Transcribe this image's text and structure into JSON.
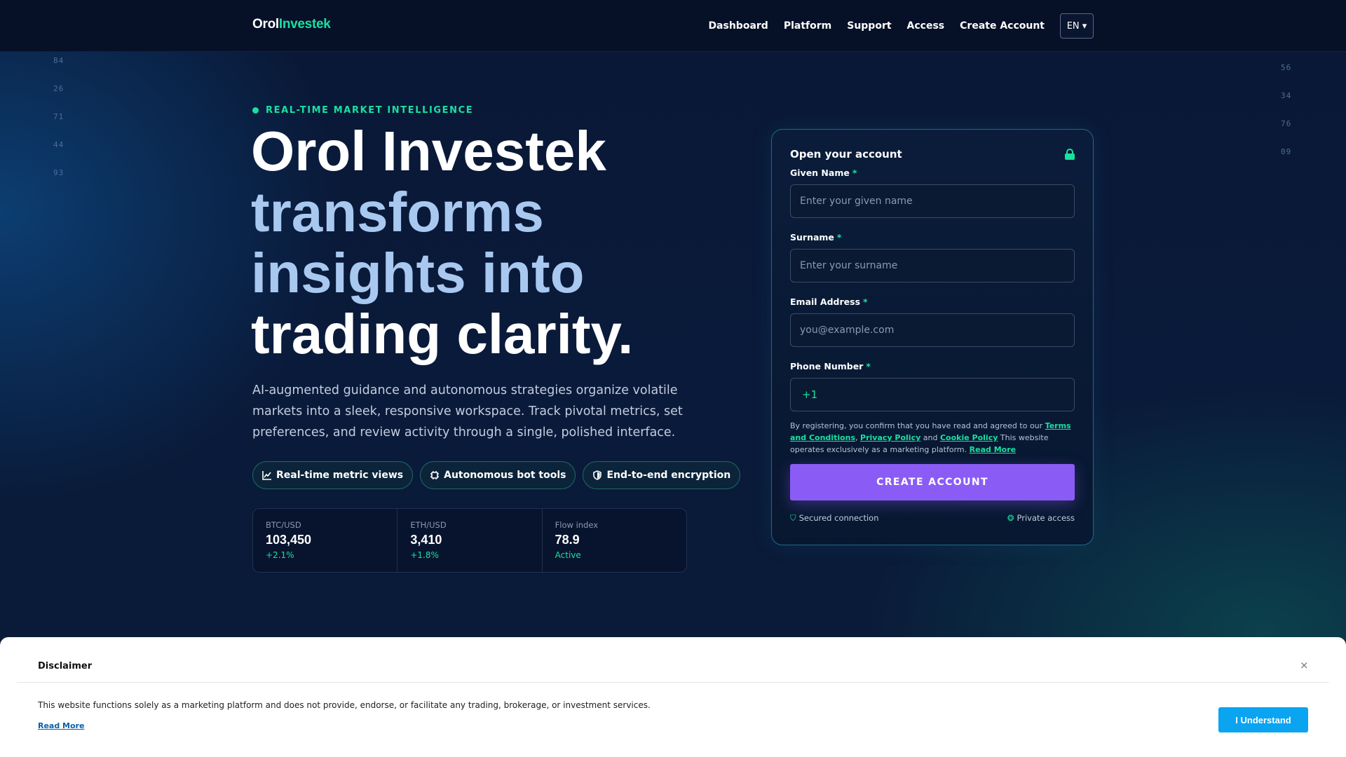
{
  "header": {
    "logo_part1": "Orol",
    "logo_part2": "Investek",
    "nav": [
      "Dashboard",
      "Platform",
      "Support",
      "Access",
      "Create Account"
    ],
    "language": "EN ▾"
  },
  "side_numbers_left": [
    "84",
    "26",
    "71",
    "44",
    "93"
  ],
  "side_numbers_right": [
    "56",
    "34",
    "76",
    "09"
  ],
  "hero": {
    "eyebrow": "REAL-TIME MARKET INTELLIGENCE",
    "title_line1": "Orol Investek",
    "title_line2": "transforms",
    "title_line3": "insights into",
    "title_line4": "trading clarity.",
    "description": "AI-augmented guidance and autonomous strategies organize volatile markets into a sleek, responsive workspace. Track pivotal metrics, set preferences, and review activity through a single, polished interface.",
    "pills": [
      "Real-time metric views",
      "Autonomous bot tools",
      "End-to-end encryption"
    ],
    "stats": [
      {
        "label": "BTC/USD",
        "value": "103,450",
        "change": "+2.1%"
      },
      {
        "label": "ETH/USD",
        "value": "3,410",
        "change": "+1.8%"
      },
      {
        "label": "Flow index",
        "value": "78.9",
        "change": "Active"
      }
    ]
  },
  "form": {
    "title": "Open your account",
    "given_name_label": "Given Name",
    "given_name_placeholder": "Enter your given name",
    "surname_label": "Surname",
    "surname_placeholder": "Enter your surname",
    "email_label": "Email Address",
    "email_placeholder": "you@example.com",
    "phone_label": "Phone Number",
    "phone_code": "+1",
    "required_mark": "*",
    "legal_1": "By registering, you confirm that you have read and agreed to our ",
    "terms": "Terms and Conditions",
    "comma": ", ",
    "privacy": "Privacy Policy",
    "and": " and ",
    "cookie": "Cookie Policy",
    "legal_2": " This website operates exclusively as a marketing platform. ",
    "read_more": "Read More",
    "submit": "CREATE ACCOUNT",
    "secured": "Secured connection",
    "private": "Private access"
  },
  "disclaimer": {
    "title": "Disclaimer",
    "text": "This website functions solely as a marketing platform and does not provide, endorse, or facilitate any trading, brokerage, or investment services.",
    "read_more": "Read More",
    "button": "I Understand",
    "close": "×"
  }
}
